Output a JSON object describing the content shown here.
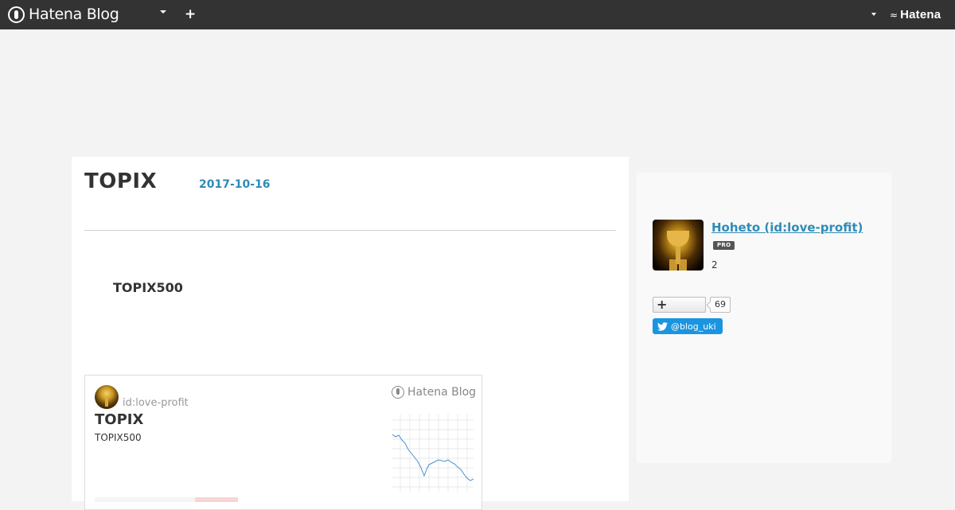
{
  "navbar": {
    "brand": "Hatena Blog",
    "menu_caret": "caret-down-icon",
    "add_button": "+",
    "account_caret": "caret-down-icon",
    "hatena_logo": "Hatena"
  },
  "entry": {
    "title": "TOPIX",
    "date": "2017-10-16",
    "heading": "TOPIX500"
  },
  "embed_card": {
    "user": "id:love-profit",
    "title": "TOPIX",
    "description": "TOPIX500",
    "brand": "Hatena Blog",
    "thumbnail_icon": "line-chart-thumbnail"
  },
  "sidebar": {
    "profile_name": "Hoheto (id:love-profit)",
    "badge": "PRO",
    "count": "2",
    "follow_label": "+",
    "follower_count": "69",
    "twitter_handle": "@blog_uki"
  },
  "colors": {
    "navbar_bg": "#333333",
    "link_blue": "#2f8bb7",
    "twitter_blue": "#1b95e0",
    "page_bg": "#f3f3f3"
  }
}
